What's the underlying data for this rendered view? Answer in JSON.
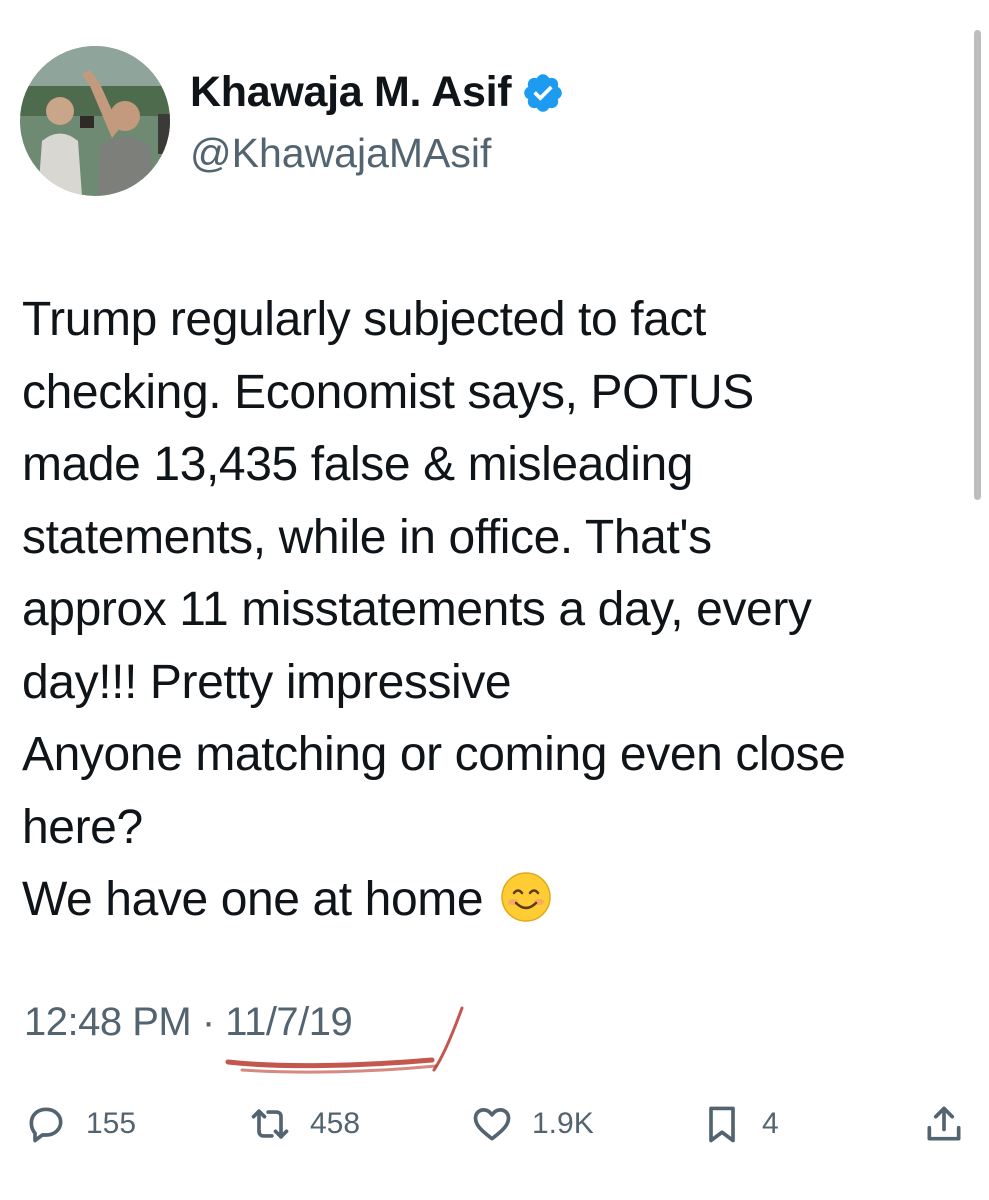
{
  "author": {
    "display_name": "Khawaja M. Asif",
    "handle": "@KhawajaMAsif",
    "verified_icon": "verified-badge-icon",
    "verified_color": "#1d9bf0"
  },
  "tweet": {
    "lines": [
      "Trump regularly subjected to fact",
      "checking. Economist says, POTUS",
      "made 13,435 false & misleading",
      "statements, while in office. That's",
      "approx 11 misstatements a day, every",
      "day!!! Pretty impressive",
      "Anyone matching or coming even close",
      "here?",
      "We have one at home"
    ],
    "emoji": "smiling-face-icon"
  },
  "meta": {
    "time": "12:48 PM",
    "separator": "·",
    "date": "11/7/19"
  },
  "actions": {
    "reply_count": "155",
    "retweet_count": "458",
    "like_count": "1.9K",
    "bookmark_count": "4"
  },
  "colors": {
    "text": "#0f1419",
    "secondary": "#536471",
    "accent": "#1d9bf0",
    "scribble": "#b83a2e"
  }
}
